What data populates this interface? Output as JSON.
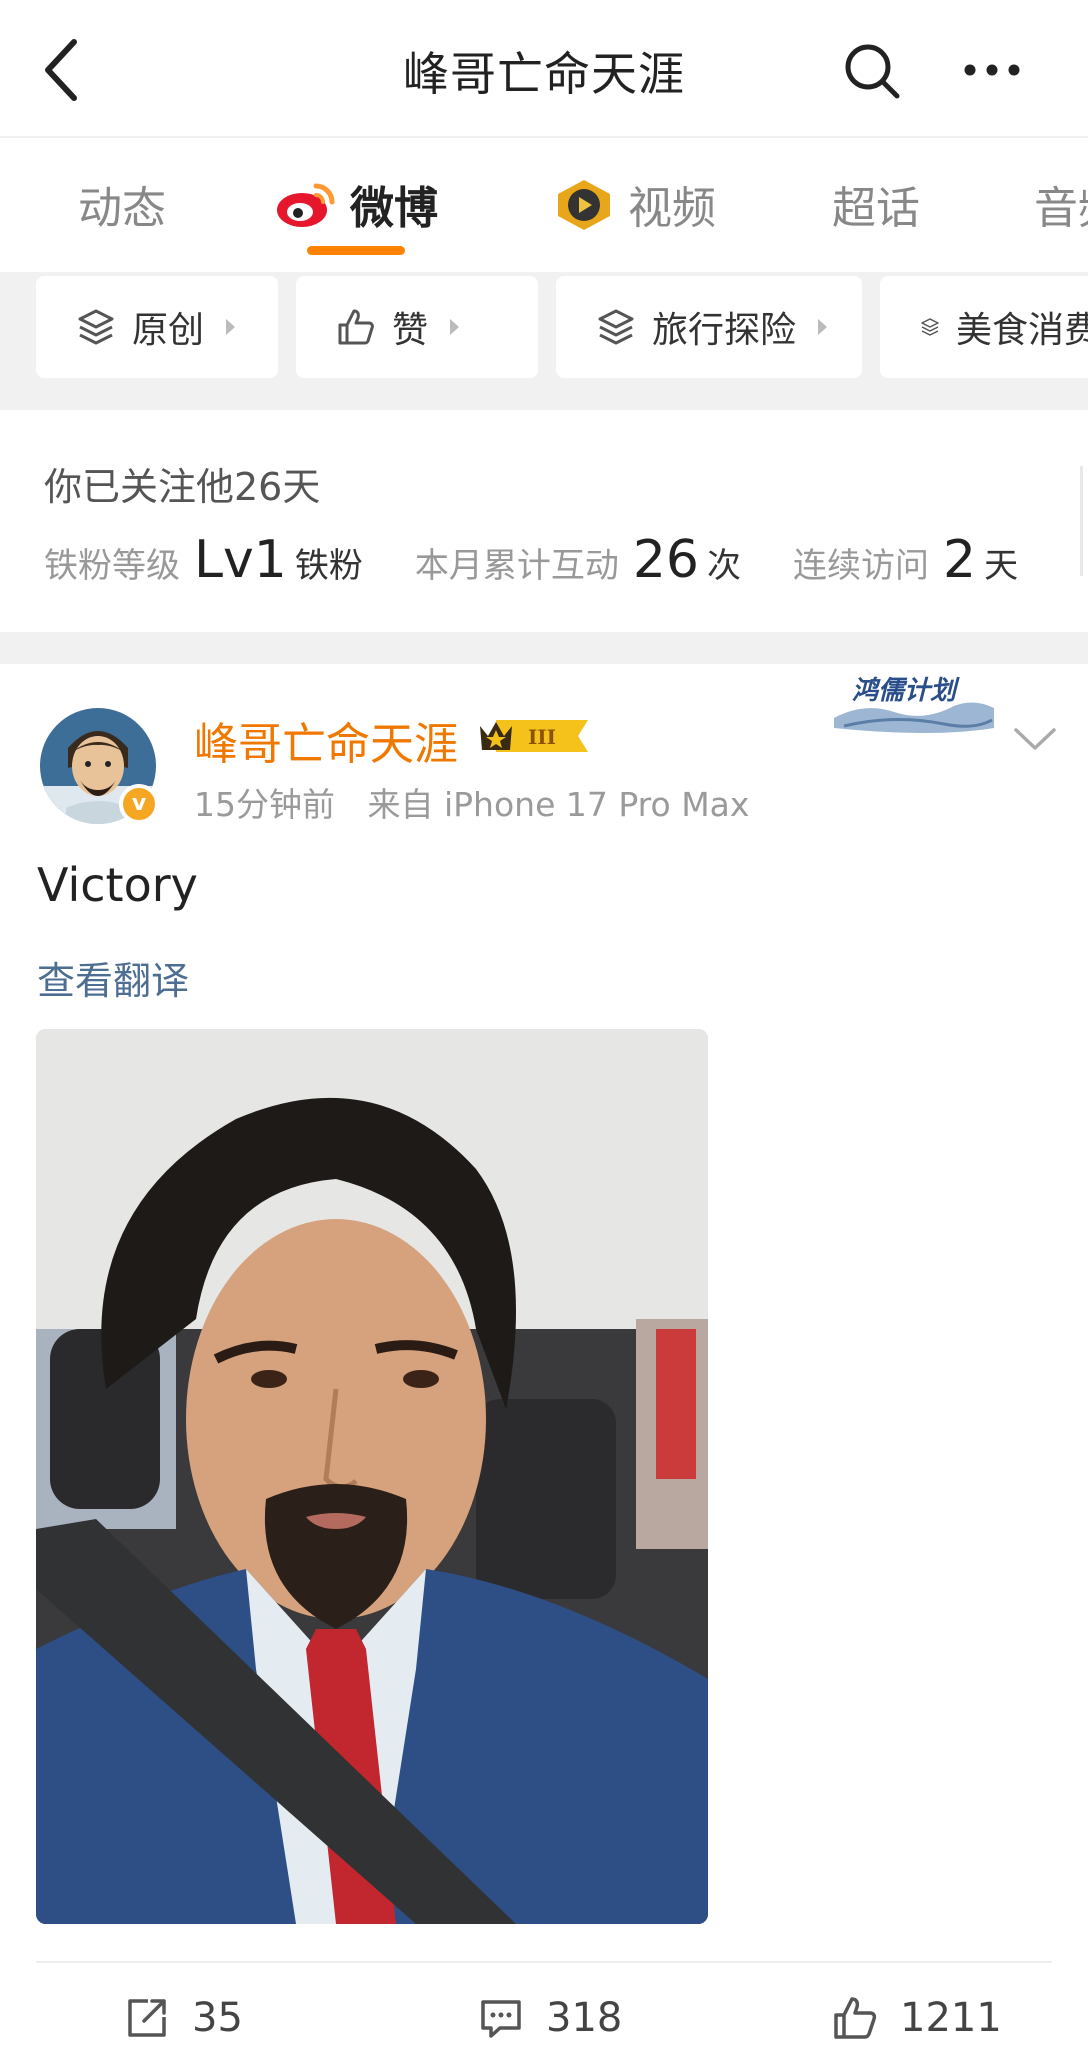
{
  "topbar": {
    "title": "峰哥亡命天涯"
  },
  "tabs": [
    {
      "label": "动态"
    },
    {
      "label": "微博"
    },
    {
      "label": "视频"
    },
    {
      "label": "超话"
    },
    {
      "label": "音频"
    }
  ],
  "chips": [
    {
      "label": "原创"
    },
    {
      "label": "赞"
    },
    {
      "label": "旅行探险"
    },
    {
      "label": "美食消费"
    }
  ],
  "follow": {
    "followed_text": "你已关注他26天",
    "fan_level_label": "铁粉等级",
    "fan_level_value": "Lv1",
    "fan_level_unit": "铁粉",
    "interact_label": "本月累计互动",
    "interact_value": "26",
    "interact_unit": "次",
    "visit_label": "连续访问",
    "visit_value": "2",
    "visit_unit": "天"
  },
  "post": {
    "author": "峰哥亡命天涯",
    "crown_level": "III",
    "verified_mark": "v",
    "time": "15分钟前",
    "source": "来自 iPhone 17 Pro Max",
    "plan_badge": "鸿儒计划",
    "text": "Victory",
    "translate_link": "查看翻译",
    "reposts": "35",
    "comments": "318",
    "likes": "1211"
  },
  "colors": {
    "accent_orange": "#ff8200",
    "username_orange": "#f07800",
    "link_blue": "#4e6d93",
    "divider_gray": "#f1f1f1"
  }
}
